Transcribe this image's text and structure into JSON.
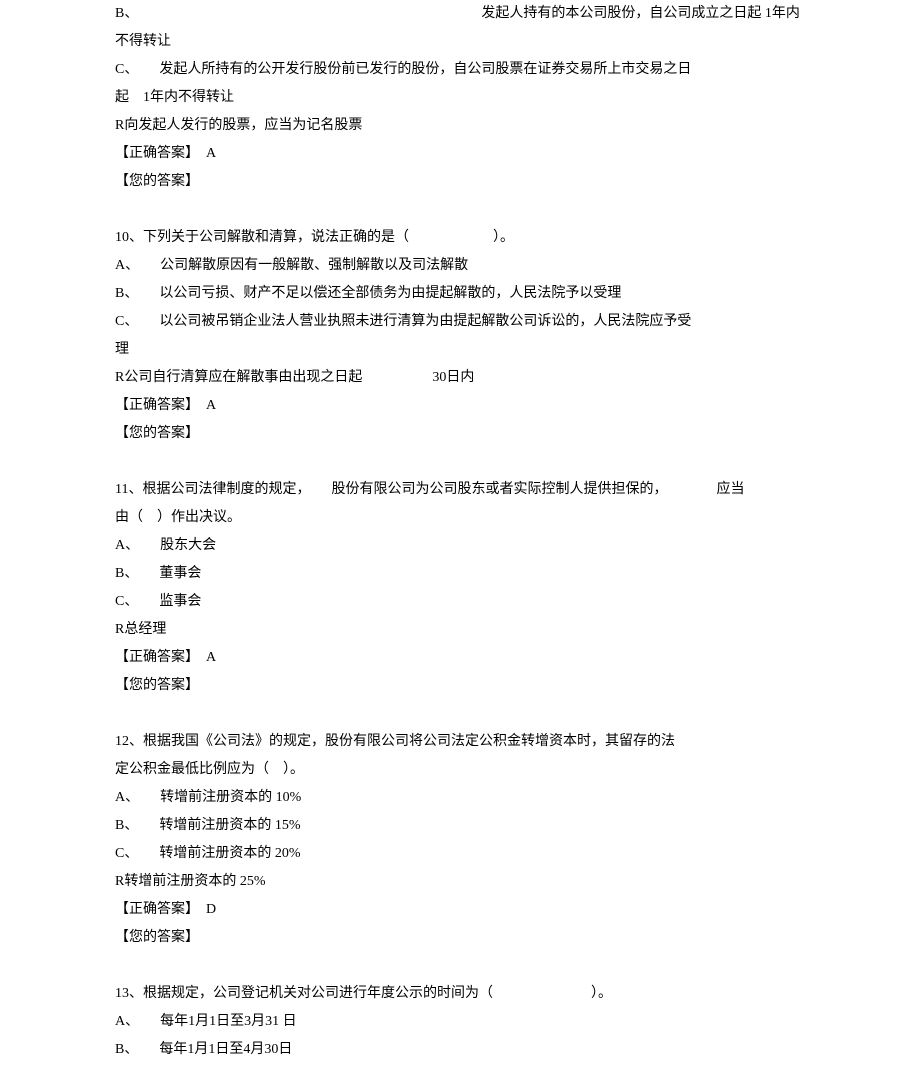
{
  "lines": [
    "B、　　　　　　　　　　　　　　　　　　　　　　　　　发起人持有的本公司股份，自公司成立之日起 1年内不得转让",
    "C、　　发起人所持有的公开发行股份前已发行的股份，自公司股票在证券交易所上市交易之日",
    "起　1年内不得转让",
    "R向发起人发行的股票，应当为记名股票",
    "【正确答案】　A",
    "【您的答案】",
    "",
    "10、下列关于公司解散和清算，说法正确的是（　　　　　　）。",
    "A、　　公司解散原因有一般解散、强制解散以及司法解散",
    "B、　　以公司亏损、财产不足以偿还全部债务为由提起解散的，人民法院予以受理",
    "C、　　以公司被吊销企业法人营业执照未进行清算为由提起解散公司诉讼的，人民法院应予受",
    "理",
    "R公司自行清算应在解散事由出现之日起　　　　　30日内",
    "【正确答案】　A",
    "【您的答案】",
    "",
    "11、根据公司法律制度的规定，　　股份有限公司为公司股东或者实际控制人提供担保的，　　　　应当",
    "由（　）作出决议。",
    "A、　　股东大会",
    "B、　　董事会",
    "C、　　监事会",
    "R总经理",
    "【正确答案】　A",
    "【您的答案】",
    "",
    "12、根据我国《公司法》的规定，股份有限公司将公司法定公积金转增资本时，其留存的法",
    "定公积金最低比例应为（　）。",
    "A、　　转增前注册资本的 10%",
    "B、　　转增前注册资本的 15%",
    "C、　　转增前注册资本的 20%",
    "R转增前注册资本的 25%",
    "【正确答案】　D",
    "【您的答案】",
    "",
    "13、根据规定，公司登记机关对公司进行年度公示的时间为（　　　　　　　）。",
    "A、　　每年1月1日至3月31 日",
    "B、　　每年1月1日至4月30日"
  ]
}
